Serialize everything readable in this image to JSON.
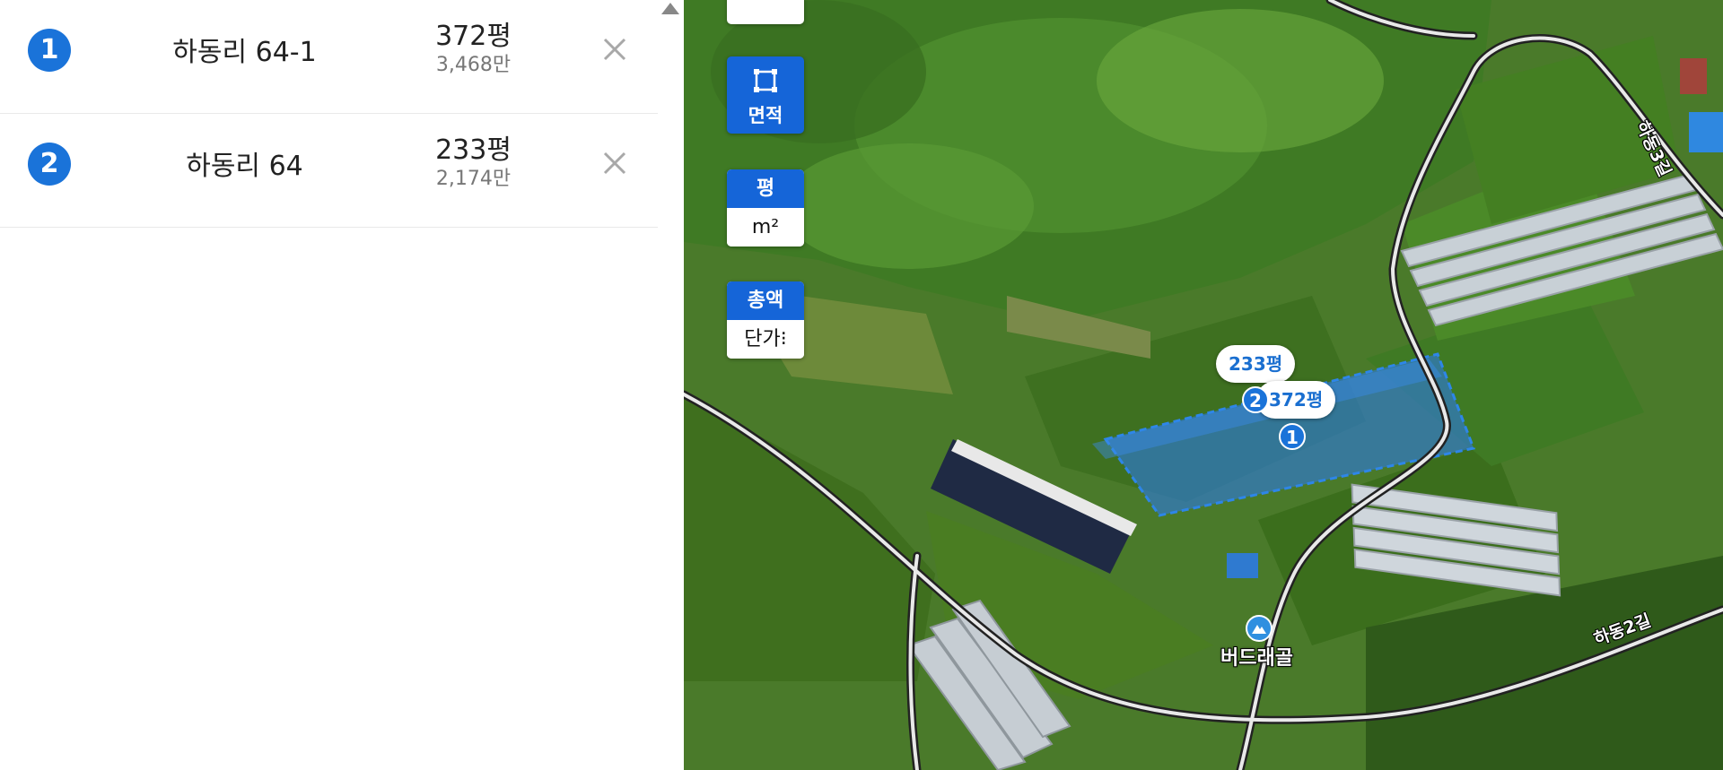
{
  "parcels": [
    {
      "num": "1",
      "name": "하동리 64-1",
      "area": "372평",
      "price": "3,468만"
    },
    {
      "num": "2",
      "name": "하동리 64",
      "area": "233평",
      "price": "2,174만"
    }
  ],
  "controls": {
    "area_label": "면적",
    "unit_pyeong": "평",
    "unit_sqm": "m²",
    "total_label": "총액",
    "unit_price_label": "단가⁝"
  },
  "map": {
    "tag_2_area": "233평",
    "tag_1_area": "372평",
    "pin_1": "1",
    "pin_2": "2",
    "place_name": "버드래골",
    "road_1": "하동3길",
    "road_2": "하동2길"
  },
  "colors": {
    "accent": "#1a73d9",
    "button_blue": "#1565d8"
  }
}
